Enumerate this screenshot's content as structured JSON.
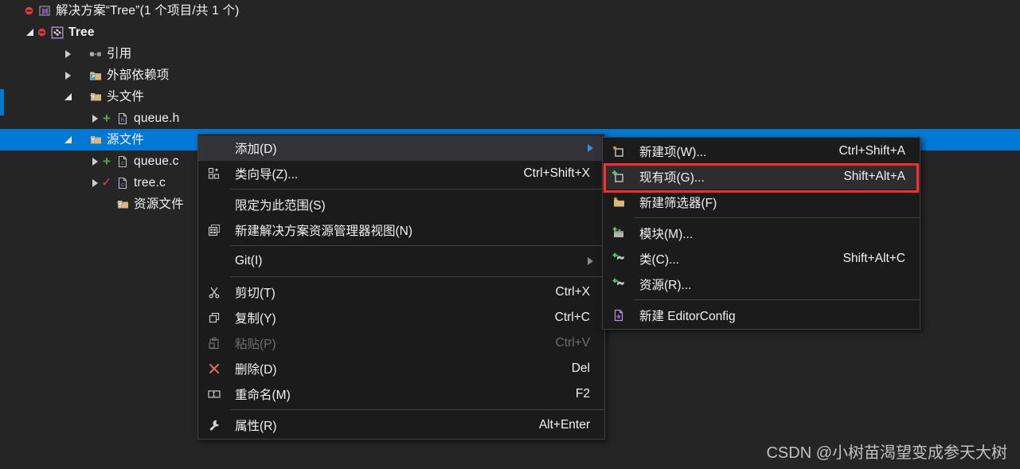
{
  "tree": {
    "items": [
      {
        "label": "解决方案“Tree”(1 个项目/共 1 个)",
        "indent": 14,
        "expander": "none",
        "icon": "solution-icon",
        "status": "error",
        "bold": false,
        "selected": false
      },
      {
        "label": "Tree",
        "indent": 30,
        "expander": "down",
        "icon": "project-icon",
        "status": "error",
        "bold": true,
        "selected": false
      },
      {
        "label": "引用",
        "indent": 78,
        "expander": "right",
        "icon": "references-icon",
        "status": "none",
        "bold": false,
        "selected": false
      },
      {
        "label": "外部依赖项",
        "indent": 78,
        "expander": "right",
        "icon": "external-dependencies-icon",
        "status": "none",
        "bold": false,
        "selected": false
      },
      {
        "label": "头文件",
        "indent": 78,
        "expander": "down",
        "icon": "filter-folder-icon",
        "status": "none",
        "bold": false,
        "selected": false
      },
      {
        "label": "queue.h",
        "indent": 112,
        "expander": "right",
        "icon": "header-file-icon",
        "status": "added",
        "bold": false,
        "selected": false
      },
      {
        "label": "源文件",
        "indent": 78,
        "expander": "down",
        "icon": "filter-folder-icon",
        "status": "none",
        "bold": false,
        "selected": true
      },
      {
        "label": "queue.c",
        "indent": 112,
        "expander": "right",
        "icon": "c-file-icon",
        "status": "added",
        "bold": false,
        "selected": false
      },
      {
        "label": "tree.c",
        "indent": 112,
        "expander": "right",
        "icon": "c-file-icon",
        "status": "checked",
        "bold": false,
        "selected": false
      },
      {
        "label": "资源文件",
        "indent": 112,
        "expander": "none",
        "icon": "filter-folder-icon",
        "status": "none",
        "bold": false,
        "selected": false
      }
    ]
  },
  "context_menu": {
    "name": "solution-explorer-context-menu",
    "items": [
      {
        "label": "添加(D)",
        "shortcut": "",
        "icon": "none",
        "submenu": true,
        "highlighted": true,
        "disabled": false,
        "separator_after": false
      },
      {
        "label": "类向导(Z)...",
        "shortcut": "Ctrl+Shift+X",
        "icon": "class-wizard-icon",
        "submenu": false,
        "highlighted": false,
        "disabled": false,
        "separator_after": true
      },
      {
        "label": "限定为此范围(S)",
        "shortcut": "",
        "icon": "none",
        "submenu": false,
        "highlighted": false,
        "disabled": false,
        "separator_after": false
      },
      {
        "label": "新建解决方案资源管理器视图(N)",
        "shortcut": "",
        "icon": "new-solution-explorer-view-icon",
        "submenu": false,
        "highlighted": false,
        "disabled": false,
        "separator_after": true
      },
      {
        "label": "Git(I)",
        "shortcut": "",
        "icon": "none",
        "submenu": true,
        "highlighted": false,
        "disabled": false,
        "separator_after": true
      },
      {
        "label": "剪切(T)",
        "shortcut": "Ctrl+X",
        "icon": "scissors-icon",
        "submenu": false,
        "highlighted": false,
        "disabled": false,
        "separator_after": false
      },
      {
        "label": "复制(Y)",
        "shortcut": "Ctrl+C",
        "icon": "copy-icon",
        "submenu": false,
        "highlighted": false,
        "disabled": false,
        "separator_after": false
      },
      {
        "label": "粘贴(P)",
        "shortcut": "Ctrl+V",
        "icon": "paste-icon",
        "submenu": false,
        "highlighted": false,
        "disabled": true,
        "separator_after": false
      },
      {
        "label": "删除(D)",
        "shortcut": "Del",
        "icon": "delete-x-icon",
        "submenu": false,
        "highlighted": false,
        "disabled": false,
        "separator_after": false
      },
      {
        "label": "重命名(M)",
        "shortcut": "F2",
        "icon": "rename-icon",
        "submenu": false,
        "highlighted": false,
        "disabled": false,
        "separator_after": true
      },
      {
        "label": "属性(R)",
        "shortcut": "Alt+Enter",
        "icon": "wrench-icon",
        "submenu": false,
        "highlighted": false,
        "disabled": false,
        "separator_after": false
      }
    ]
  },
  "submenu": {
    "name": "add-submenu",
    "items": [
      {
        "label": "新建项(W)...",
        "shortcut": "Ctrl+Shift+A",
        "icon": "new-item-icon",
        "highlighted": false,
        "outlined": false,
        "separator_after": false
      },
      {
        "label": "现有项(G)...",
        "shortcut": "Shift+Alt+A",
        "icon": "existing-item-icon",
        "highlighted": true,
        "outlined": true,
        "separator_after": false
      },
      {
        "label": "新建筛选器(F)",
        "shortcut": "",
        "icon": "new-filter-icon",
        "highlighted": false,
        "outlined": false,
        "separator_after": true
      },
      {
        "label": "模块(M)...",
        "shortcut": "",
        "icon": "new-module-icon",
        "highlighted": false,
        "outlined": false,
        "separator_after": false
      },
      {
        "label": "类(C)...",
        "shortcut": "Shift+Alt+C",
        "icon": "new-class-icon",
        "highlighted": false,
        "outlined": false,
        "separator_after": false
      },
      {
        "label": "资源(R)...",
        "shortcut": "",
        "icon": "new-resource-icon",
        "highlighted": false,
        "outlined": false,
        "separator_after": true
      },
      {
        "label": "新建 EditorConfig",
        "shortcut": "",
        "icon": "editorconfig-icon",
        "highlighted": false,
        "outlined": false,
        "separator_after": false
      }
    ]
  },
  "watermark": {
    "text": "CSDN @小树苗渴望变成参天大树"
  },
  "colors": {
    "background": "#252526",
    "selection": "#0078d4",
    "menu_background": "#1b1b1c",
    "menu_border": "#3f3f46",
    "highlight_row": "#333337",
    "highlight_outline": "#ff2d2d",
    "text": "#f1f1f1",
    "disabled_text": "#6d6d6d",
    "added_marker": "#57a64a",
    "checked_marker": "#e03a3a"
  }
}
